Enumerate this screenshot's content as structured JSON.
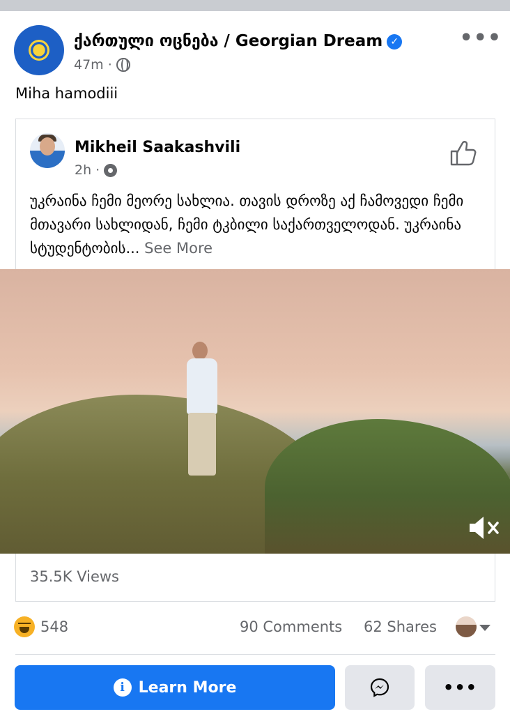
{
  "post": {
    "page_name": "ქართული ოცნება / Georgian Dream",
    "time": "47m",
    "separator": "·",
    "text": "Miha hamodiii",
    "more_icon": "•••"
  },
  "shared_post": {
    "author": "Mikheil Saakashvili",
    "time": "2h",
    "separator": "·",
    "body": "უკრაინა ჩემი მეორე სახლია. თავის დროზე აქ ჩამოვედი ჩემი მთავარი სახლიდან, ჩემი ტკბილი საქართველოდან. უკრაინა სტუდენტობის...",
    "see_more": "See More"
  },
  "video": {
    "views": "35.5K Views",
    "muted": true
  },
  "reactions": {
    "count": "548",
    "comments": "90 Comments",
    "shares": "62 Shares"
  },
  "actions": {
    "learn_more": "Learn More",
    "more": "•••"
  },
  "icons": {
    "verified": "verified-badge-icon",
    "audience": "globe-icon",
    "shared_audience": "gear-icon",
    "like": "thumbs-up-icon",
    "mute": "speaker-muted-icon",
    "reaction": "haha-emoji-icon",
    "info": "info-icon",
    "messenger": "messenger-icon"
  },
  "colors": {
    "accent": "#1877f2",
    "secondary_text": "#65676b",
    "button_gray": "#e4e6eb"
  }
}
